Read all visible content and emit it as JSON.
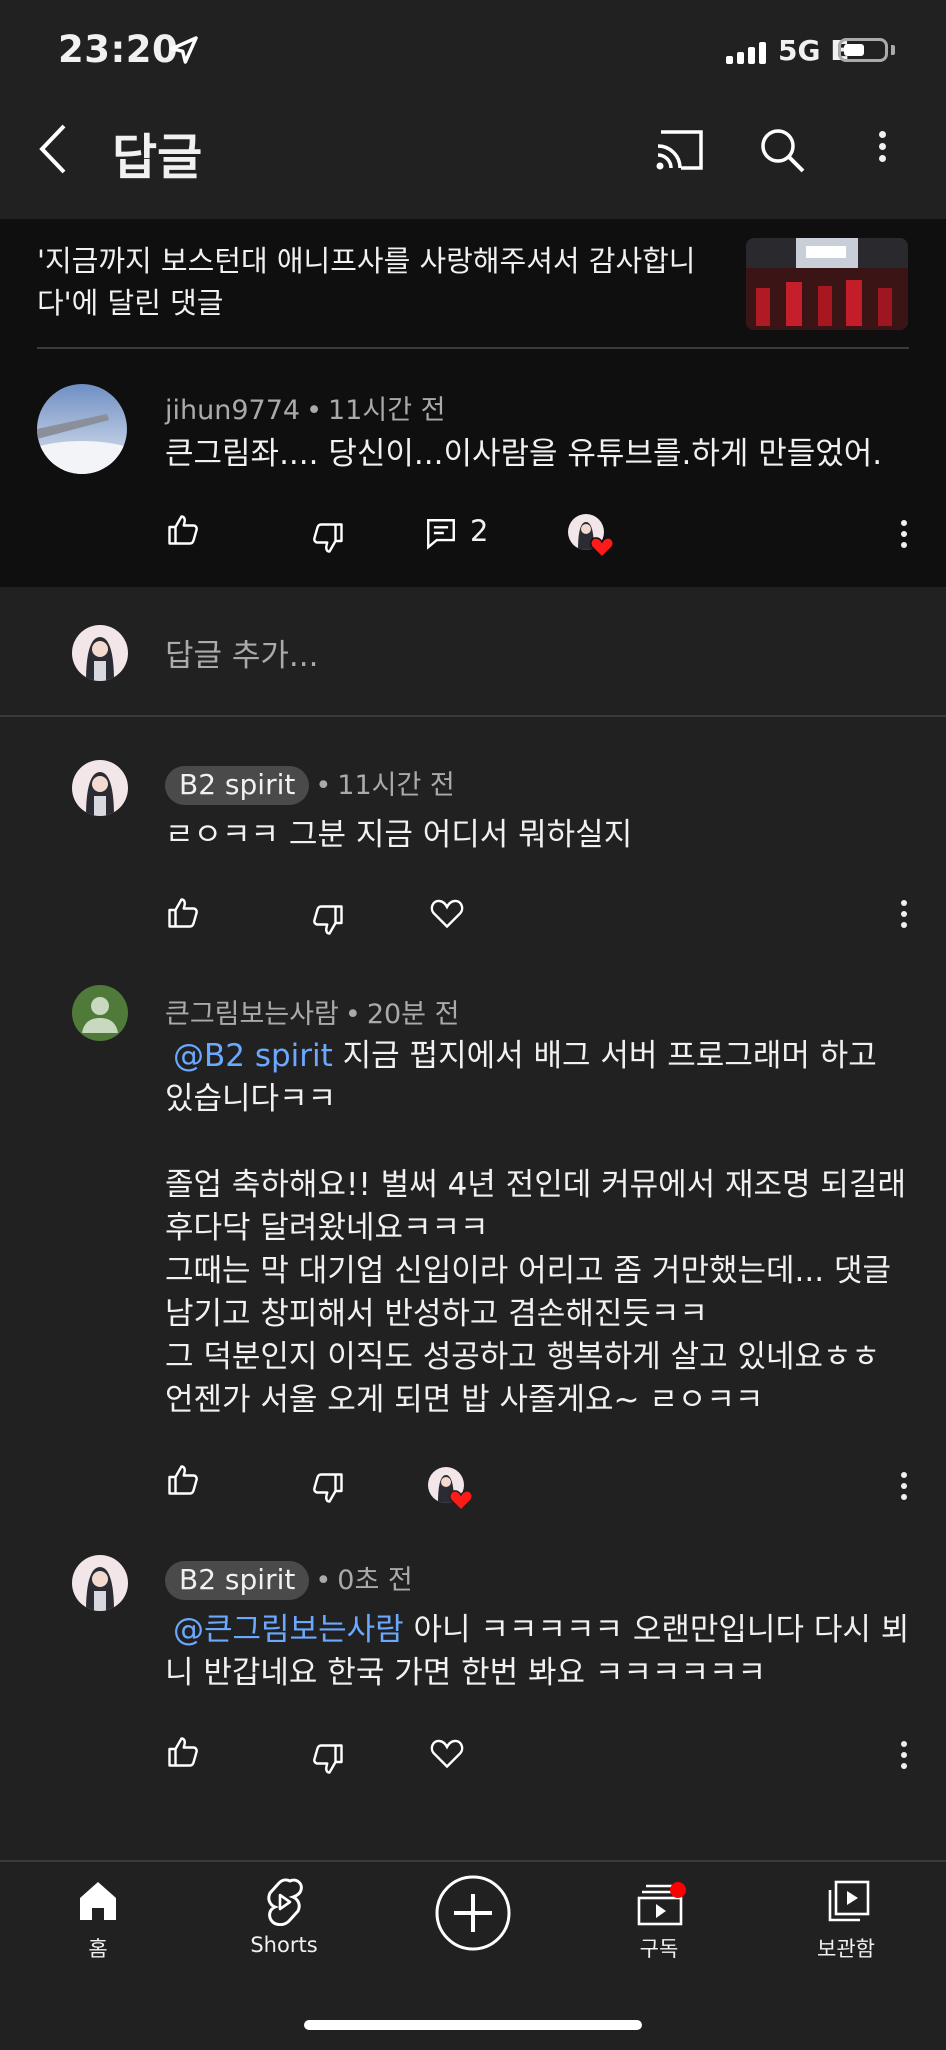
{
  "status_bar": {
    "time": "23:20",
    "network": "5G E"
  },
  "header": {
    "title": "답글"
  },
  "video_context": {
    "title": "'지금까지 보스턴대 애니프사를 사랑해주셔서 감사합니다'에 달린 댓글"
  },
  "main_comment": {
    "author": "jihun9774",
    "time": "11시간 전",
    "text": "큰그림좌.... 당신이...이사람을 유튜브를.하게 만들었어.",
    "reply_count": "2"
  },
  "reply_input": {
    "placeholder": "답글 추가..."
  },
  "replies": [
    {
      "author": "B2 spirit",
      "time": "11시간 전",
      "text": "ㄹㅇㅋㅋ 그분 지금 어디서 뭐하실지"
    },
    {
      "author": "큰그림보는사람",
      "time": "20분 전",
      "mention": "@B2 spirit",
      "text": " 지금 펍지에서 배그 서버 프로그래머 하고 있습니다ㅋㅋ\n\n졸업 축하해요!! 벌써 4년 전인데 커뮤에서 재조명 되길래 후다닥 달려왔네요ㅋㅋㅋ\n그때는 막 대기업 신입이라 어리고 좀 거만했는데... 댓글 남기고 창피해서 반성하고 겸손해진듯ㅋㅋ\n그 덕분인지 이직도 성공하고 행복하게 살고 있네요ㅎㅎ\n언젠가 서울 오게 되면 밥 사줄게요~ ㄹㅇㅋㅋ"
    },
    {
      "author": "B2 spirit",
      "time": "0초 전",
      "mention": "@큰그림보는사람",
      "text": " 아니 ㅋㅋㅋㅋㅋ 오랜만입니다 다시 뵈니 반갑네요 한국 가면 한번 봐요 ㅋㅋㅋㅋㅋㅋ"
    }
  ],
  "bottom_nav": [
    {
      "label": "홈",
      "icon": "home-icon"
    },
    {
      "label": "Shorts",
      "icon": "shorts-icon"
    },
    {
      "label": "",
      "icon": "create-icon"
    },
    {
      "label": "구독",
      "icon": "subscriptions-icon"
    },
    {
      "label": "보관함",
      "icon": "library-icon"
    }
  ],
  "colors": {
    "background": "#212121",
    "mention": "#6ba8ff",
    "heart": "#ff0000"
  }
}
